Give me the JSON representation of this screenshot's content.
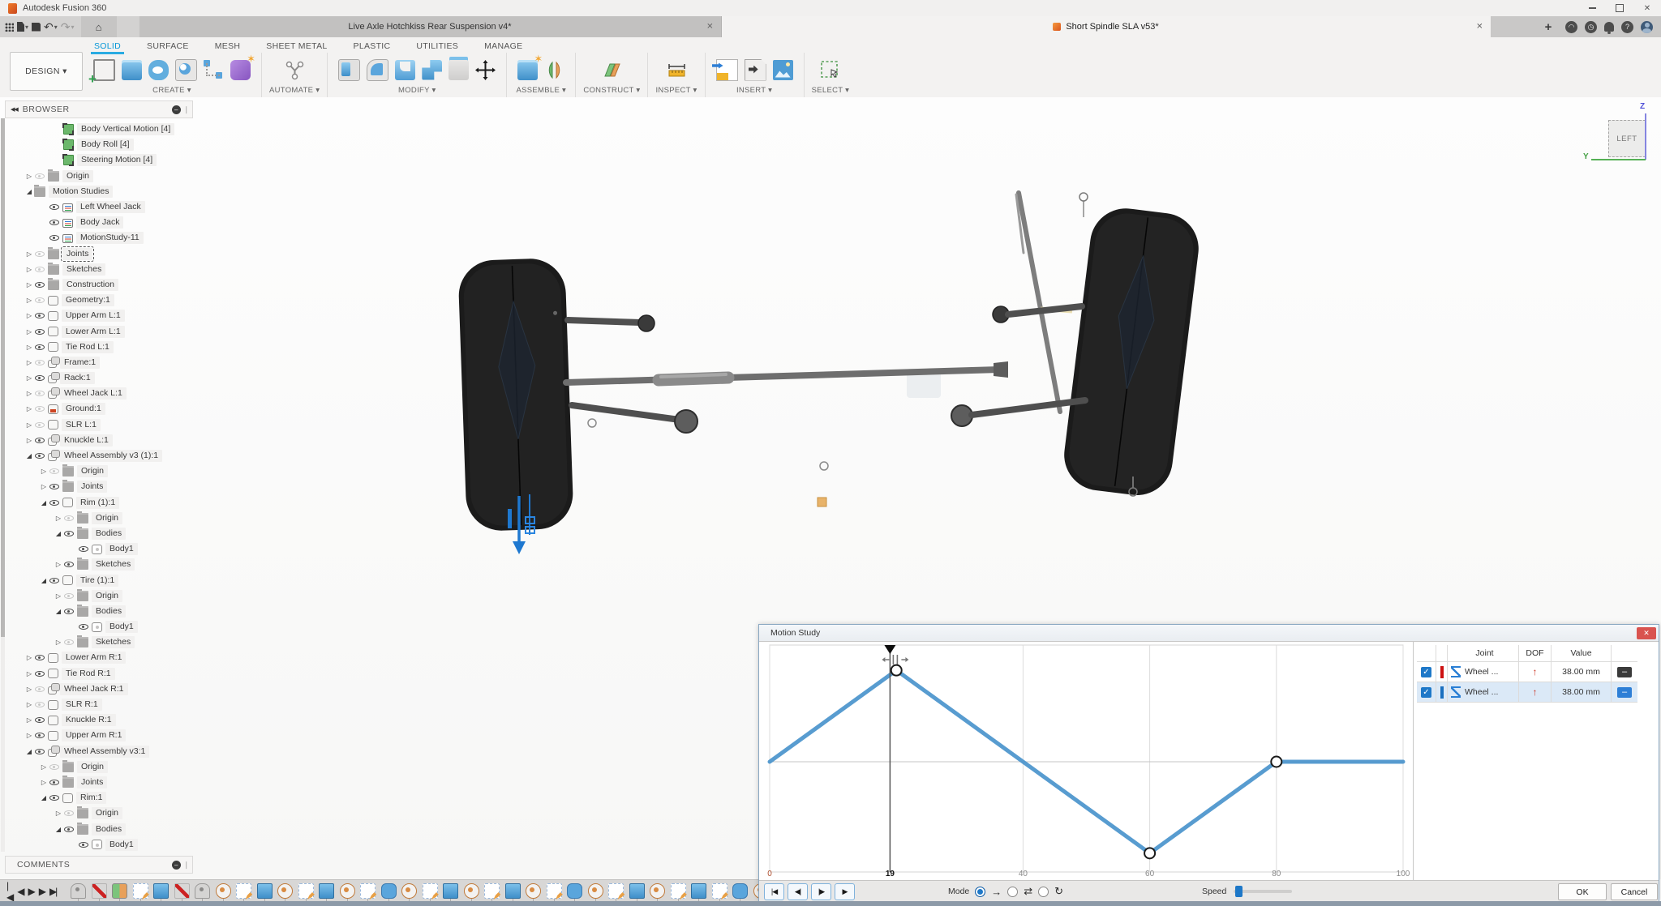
{
  "window": {
    "app_title": "Autodesk Fusion 360"
  },
  "icons": {
    "close": "✕",
    "plus": "+",
    "caret": "▾",
    "home": "⌂",
    "undo": "↶",
    "redo": "↷",
    "help": "?",
    "collapse": "◀◀",
    "grip": "❘",
    "badge_minus": "–"
  },
  "tabs": {
    "doc1": {
      "label": "Live Axle Hotchkiss  Rear Suspension v4*"
    },
    "doc2": {
      "label": "Short Spindle SLA v53*"
    }
  },
  "ribbon": {
    "workspace_label": "DESIGN ▾",
    "tabs": [
      "SOLID",
      "SURFACE",
      "MESH",
      "SHEET METAL",
      "PLASTIC",
      "UTILITIES",
      "MANAGE"
    ],
    "active_tab": "SOLID",
    "groups": [
      {
        "label": "CREATE ▾"
      },
      {
        "label": "AUTOMATE ▾"
      },
      {
        "label": "MODIFY ▾"
      },
      {
        "label": "ASSEMBLE ▾"
      },
      {
        "label": "CONSTRUCT ▾"
      },
      {
        "label": "INSPECT ▾"
      },
      {
        "label": "INSERT ▾"
      },
      {
        "label": "SELECT ▾"
      }
    ]
  },
  "browser": {
    "title": "BROWSER",
    "items": [
      {
        "label": "Body Vertical Motion [4]",
        "level": 3,
        "arrow": "none",
        "eye": "none",
        "icon": "set"
      },
      {
        "label": "Body Roll [4]",
        "level": 3,
        "arrow": "none",
        "eye": "none",
        "icon": "set"
      },
      {
        "label": "Steering Motion [4]",
        "level": 3,
        "arrow": "none",
        "eye": "none",
        "icon": "set"
      },
      {
        "label": "Origin",
        "level": 1,
        "arrow": "closed",
        "eye": "off",
        "icon": "folder"
      },
      {
        "label": "Motion Studies",
        "level": 1,
        "arrow": "open",
        "eye": "none",
        "icon": "folder"
      },
      {
        "label": "Left Wheel Jack",
        "level": 2,
        "arrow": "none",
        "eye": "on",
        "icon": "study"
      },
      {
        "label": "Body Jack",
        "level": 2,
        "arrow": "none",
        "eye": "on",
        "icon": "study"
      },
      {
        "label": "MotionStudy-11",
        "level": 2,
        "arrow": "none",
        "eye": "on",
        "icon": "study"
      },
      {
        "label": "Joints",
        "level": 1,
        "arrow": "closed",
        "eye": "off",
        "icon": "folder",
        "dashed": true
      },
      {
        "label": "Sketches",
        "level": 1,
        "arrow": "closed",
        "eye": "off",
        "icon": "folder"
      },
      {
        "label": "Construction",
        "level": 1,
        "arrow": "closed",
        "eye": "on",
        "icon": "folder"
      },
      {
        "label": "Geometry:1",
        "level": 1,
        "arrow": "closed",
        "eye": "off",
        "icon": "component"
      },
      {
        "label": "Upper Arm L:1",
        "level": 1,
        "arrow": "closed",
        "eye": "on",
        "icon": "component"
      },
      {
        "label": "Lower Arm L:1",
        "level": 1,
        "arrow": "closed",
        "eye": "on",
        "icon": "component"
      },
      {
        "label": "Tie Rod L:1",
        "level": 1,
        "arrow": "closed",
        "eye": "on",
        "icon": "component"
      },
      {
        "label": "Frame:1",
        "level": 1,
        "arrow": "closed",
        "eye": "off",
        "icon": "assembly"
      },
      {
        "label": "Rack:1",
        "level": 1,
        "arrow": "closed",
        "eye": "on",
        "icon": "assembly"
      },
      {
        "label": "Wheel Jack L:1",
        "level": 1,
        "arrow": "closed",
        "eye": "off",
        "icon": "assembly"
      },
      {
        "label": "Ground:1",
        "level": 1,
        "arrow": "closed",
        "eye": "off",
        "icon": "ground"
      },
      {
        "label": "SLR L:1",
        "level": 1,
        "arrow": "closed",
        "eye": "off",
        "icon": "component"
      },
      {
        "label": "Knuckle L:1",
        "level": 1,
        "arrow": "closed",
        "eye": "on",
        "icon": "assembly"
      },
      {
        "label": "Wheel Assembly v3 (1):1",
        "level": 1,
        "arrow": "open",
        "eye": "on",
        "icon": "assembly"
      },
      {
        "label": "Origin",
        "level": 2,
        "arrow": "closed",
        "eye": "off",
        "icon": "folder"
      },
      {
        "label": "Joints",
        "level": 2,
        "arrow": "closed",
        "eye": "on",
        "icon": "folder"
      },
      {
        "label": "Rim (1):1",
        "level": 2,
        "arrow": "open",
        "eye": "on",
        "icon": "component"
      },
      {
        "label": "Origin",
        "level": 3,
        "arrow": "closed",
        "eye": "off",
        "icon": "folder"
      },
      {
        "label": "Bodies",
        "level": 3,
        "arrow": "open",
        "eye": "on",
        "icon": "folder"
      },
      {
        "label": "Body1",
        "level": 4,
        "arrow": "none",
        "eye": "on",
        "icon": "body"
      },
      {
        "label": "Sketches",
        "level": 3,
        "arrow": "closed",
        "eye": "on",
        "icon": "folder"
      },
      {
        "label": "Tire (1):1",
        "level": 2,
        "arrow": "open",
        "eye": "on",
        "icon": "component"
      },
      {
        "label": "Origin",
        "level": 3,
        "arrow": "closed",
        "eye": "off",
        "icon": "folder"
      },
      {
        "label": "Bodies",
        "level": 3,
        "arrow": "open",
        "eye": "on",
        "icon": "folder"
      },
      {
        "label": "Body1",
        "level": 4,
        "arrow": "none",
        "eye": "on",
        "icon": "body"
      },
      {
        "label": "Sketches",
        "level": 3,
        "arrow": "closed",
        "eye": "off",
        "icon": "folder"
      },
      {
        "label": "Lower Arm R:1",
        "level": 1,
        "arrow": "closed",
        "eye": "on",
        "icon": "component"
      },
      {
        "label": "Tie Rod R:1",
        "level": 1,
        "arrow": "closed",
        "eye": "on",
        "icon": "component"
      },
      {
        "label": "Wheel Jack R:1",
        "level": 1,
        "arrow": "closed",
        "eye": "off",
        "icon": "assembly"
      },
      {
        "label": "SLR R:1",
        "level": 1,
        "arrow": "closed",
        "eye": "off",
        "icon": "component"
      },
      {
        "label": "Knuckle R:1",
        "level": 1,
        "arrow": "closed",
        "eye": "on",
        "icon": "component"
      },
      {
        "label": "Upper Arm R:1",
        "level": 1,
        "arrow": "closed",
        "eye": "on",
        "icon": "component"
      },
      {
        "label": "Wheel Assembly v3:1",
        "level": 1,
        "arrow": "open",
        "eye": "on",
        "icon": "assembly"
      },
      {
        "label": "Origin",
        "level": 2,
        "arrow": "closed",
        "eye": "off",
        "icon": "folder"
      },
      {
        "label": "Joints",
        "level": 2,
        "arrow": "closed",
        "eye": "on",
        "icon": "folder"
      },
      {
        "label": "Rim:1",
        "level": 2,
        "arrow": "open",
        "eye": "on",
        "icon": "component"
      },
      {
        "label": "Origin",
        "level": 3,
        "arrow": "closed",
        "eye": "off",
        "icon": "folder"
      },
      {
        "label": "Bodies",
        "level": 3,
        "arrow": "open",
        "eye": "on",
        "icon": "folder"
      },
      {
        "label": "Body1",
        "level": 4,
        "arrow": "none",
        "eye": "on",
        "icon": "body"
      }
    ]
  },
  "comments": {
    "title": "COMMENTS"
  },
  "viewcube": {
    "face": "LEFT",
    "axis_z": "Z",
    "axis_y": "Y"
  },
  "timeline": {
    "playback": [
      "|◀",
      "◀",
      "▶",
      "▶",
      "▶|"
    ],
    "features": [
      "joint",
      "suppressed",
      "component",
      "sketch",
      "extrude",
      "suppressed",
      "joint",
      "revolve",
      "sketch",
      "extrude",
      "revolve",
      "sketch",
      "extrude",
      "revolve",
      "sketch",
      "form",
      "revolve",
      "sketch",
      "extrude",
      "revolve",
      "sketch",
      "extrude",
      "revolve",
      "sketch",
      "form",
      "revolve",
      "sketch",
      "extrude",
      "revolve",
      "sketch",
      "extrude",
      "sketch",
      "form",
      "revolve"
    ]
  },
  "motion_study": {
    "title": "Motion Study",
    "chart_data": {
      "type": "line",
      "title": "Motion Study joint value vs step",
      "x": [
        0,
        20,
        60,
        80,
        100
      ],
      "y": [
        0,
        38,
        -38,
        0,
        0
      ],
      "keyframes": [
        [
          20,
          38
        ],
        [
          60,
          -38
        ],
        [
          80,
          0
        ]
      ],
      "playhead": 19,
      "xlim": [
        0,
        100
      ],
      "ylim": [
        -50,
        50
      ],
      "unit": "mm",
      "ticks": [
        {
          "label": "0",
          "t": 0,
          "style": "start"
        },
        {
          "label": "19",
          "t": 19,
          "style": "playhead"
        },
        {
          "label": "40",
          "t": 40,
          "style": "normal"
        },
        {
          "label": "60",
          "t": 60,
          "style": "normal"
        },
        {
          "label": "80",
          "t": 80,
          "style": "normal"
        },
        {
          "label": "100",
          "t": 100,
          "style": "normal"
        }
      ],
      "line_color": "#4a94cc",
      "grid": true
    },
    "table": {
      "headers": [
        "Joint",
        "DOF",
        "Value"
      ],
      "rows": [
        {
          "checked": true,
          "color": "#cc1111",
          "joint": "Wheel ...",
          "dof": "↑",
          "value": "38.00 mm",
          "button_bg": "#3a3a3a",
          "selected": false
        },
        {
          "checked": true,
          "color": "#1a6fbf",
          "joint": "Wheel ...",
          "dof": "↑",
          "value": "38.00 mm",
          "button_bg": "#2e7fd6",
          "selected": true
        }
      ]
    },
    "footer": {
      "playback": [
        "|◀",
        "◀|",
        "|▶",
        "▶"
      ],
      "mode_label": "Mode",
      "mode_options": [
        {
          "name": "one-way",
          "icon": "→",
          "selected": true
        },
        {
          "name": "back-and-forth",
          "icon": "⇄",
          "selected": false
        },
        {
          "name": "loop",
          "icon": "↻",
          "selected": false
        }
      ],
      "speed_label": "Speed",
      "ok_label": "OK",
      "cancel_label": "Cancel"
    }
  },
  "colors": {
    "accent_blue": "#0696d7",
    "graph_blue": "#4a94cc",
    "selection_blue": "#1e78c8",
    "close_red": "#d9534f",
    "annotation_orange": "#e8b36a"
  }
}
